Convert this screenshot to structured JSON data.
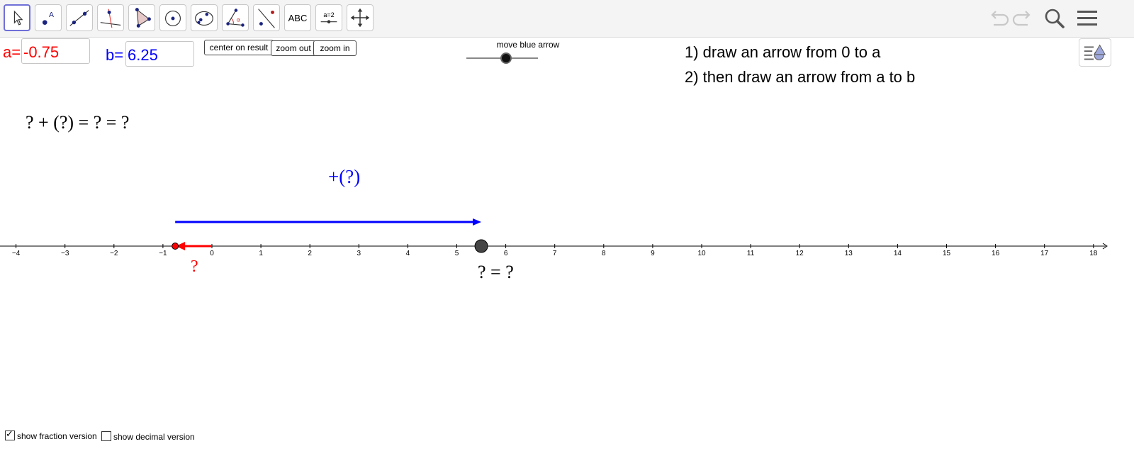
{
  "toolbar": {
    "tools": [
      {
        "name": "move",
        "icon": "cursor-arrow-icon",
        "selected": true
      },
      {
        "name": "point",
        "icon": "point-icon",
        "label": "A"
      },
      {
        "name": "line",
        "icon": "line-through-points-icon"
      },
      {
        "name": "perpendicular",
        "icon": "perpendicular-line-icon"
      },
      {
        "name": "polygon",
        "icon": "polygon-icon"
      },
      {
        "name": "circle",
        "icon": "circle-center-point-icon"
      },
      {
        "name": "ellipse",
        "icon": "ellipse-icon"
      },
      {
        "name": "angle",
        "icon": "angle-icon",
        "label": "α"
      },
      {
        "name": "reflect",
        "icon": "reflect-about-line-icon"
      },
      {
        "name": "text",
        "icon": "text-tool-icon",
        "label": "ABC"
      },
      {
        "name": "slider",
        "icon": "slider-tool-icon",
        "label": "a=2"
      },
      {
        "name": "move-graphics",
        "icon": "move-graphics-view-icon"
      }
    ],
    "right_icons": [
      "undo-icon",
      "redo-icon",
      "search-icon",
      "menu-icon"
    ]
  },
  "inputs": {
    "a": {
      "label": "a=",
      "value": "-0.75",
      "color": "#ff0000"
    },
    "b": {
      "label": "b=",
      "value": "6.25",
      "color": "#0000ff"
    }
  },
  "buttons": {
    "center": "center on result",
    "zoom_out": "zoom out",
    "zoom_in": "zoom in"
  },
  "slider": {
    "label": "move blue arrow",
    "value_fraction": 0.55
  },
  "instructions": {
    "line1": "1) draw an arrow from 0 to a",
    "line2": "2) then draw an arrow from a to b"
  },
  "math": {
    "equation": "? + (?) = ? = ?",
    "blue_label": "+(?)",
    "red_label": "?",
    "result_label": "? = ?"
  },
  "number_line": {
    "xmin": -4,
    "xmax": 18,
    "ticks": [
      "−4",
      "−3",
      "−2",
      "−1",
      "0",
      "1",
      "2",
      "3",
      "4",
      "5",
      "6",
      "7",
      "8",
      "9",
      "10",
      "11",
      "12",
      "13",
      "14",
      "15",
      "16",
      "17",
      "18"
    ]
  },
  "arrows": {
    "red": {
      "from": 0,
      "to": -0.75,
      "color": "#ff0000"
    },
    "blue": {
      "from": -0.75,
      "to": 5.5,
      "color": "#0000ff"
    }
  },
  "result_point": {
    "x": 5.5,
    "color": "#444444"
  },
  "checkboxes": [
    {
      "label": "show fraction version",
      "checked": true
    },
    {
      "label": "show decimal version",
      "checked": false
    }
  ]
}
